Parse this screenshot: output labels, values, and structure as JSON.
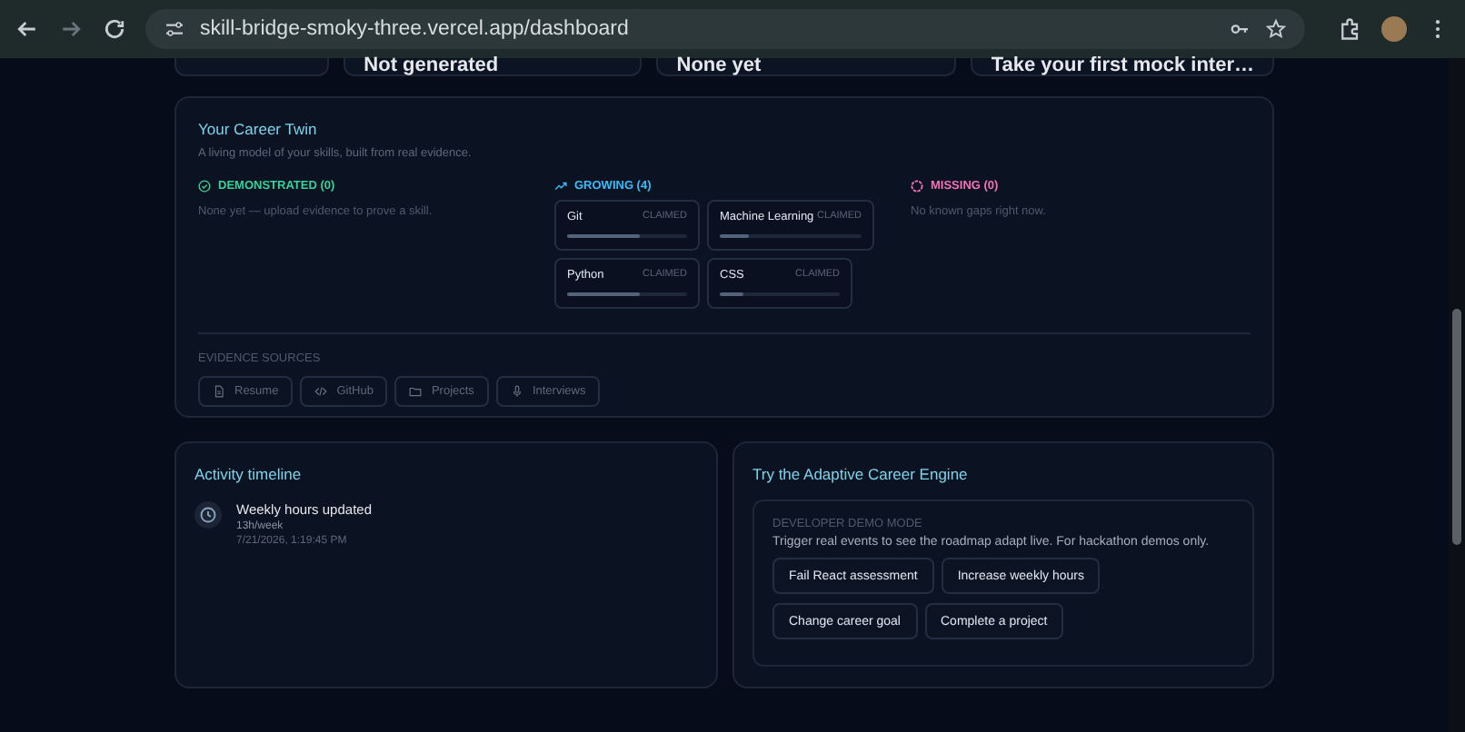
{
  "browser": {
    "url": "skill-bridge-smoky-three.vercel.app/dashboard"
  },
  "summary_cards": [
    {
      "value": "Not generated"
    },
    {
      "value": "None yet"
    },
    {
      "value": "Take your first mock inter…"
    }
  ],
  "career_twin": {
    "title": "Your Career Twin",
    "subtitle": "A living model of your skills, built from real evidence.",
    "groups": [
      {
        "kind": "demonstrated",
        "label": "DEMONSTRATED (0)",
        "color": "#34d399",
        "empty_text": "None yet — upload evidence to prove a skill."
      },
      {
        "kind": "growing",
        "label": "GROWING (4)",
        "color": "#38bdf8",
        "skills": [
          {
            "name": "Git",
            "status": "CLAIMED",
            "level": 0.6
          },
          {
            "name": "Machine Learning",
            "status": "CLAIMED",
            "level": 0.2
          },
          {
            "name": "Python",
            "status": "CLAIMED",
            "level": 0.6
          },
          {
            "name": "CSS",
            "status": "CLAIMED",
            "level": 0.2
          }
        ]
      },
      {
        "kind": "missing",
        "label": "MISSING (0)",
        "color": "#f472b6",
        "empty_text": "No known gaps right now."
      }
    ],
    "evidence_title": "EVIDENCE SOURCES",
    "evidence_sources": [
      {
        "kind": "resume",
        "label": "Resume"
      },
      {
        "kind": "github",
        "label": "GitHub"
      },
      {
        "kind": "projects",
        "label": "Projects"
      },
      {
        "kind": "interviews",
        "label": "Interviews"
      }
    ]
  },
  "activity": {
    "title": "Activity timeline",
    "events": [
      {
        "title": "Weekly hours updated",
        "detail": "13h/week",
        "time": "7/21/2026, 1:19:45 PM"
      }
    ]
  },
  "engine": {
    "title": "Try the Adaptive Career Engine",
    "mode_label": "DEVELOPER DEMO MODE",
    "description": "Trigger real events to see the roadmap adapt live. For hackathon demos only.",
    "actions": [
      [
        "Fail React assessment",
        "Increase weekly hours"
      ],
      [
        "Change career goal",
        "Complete a project"
      ]
    ]
  }
}
